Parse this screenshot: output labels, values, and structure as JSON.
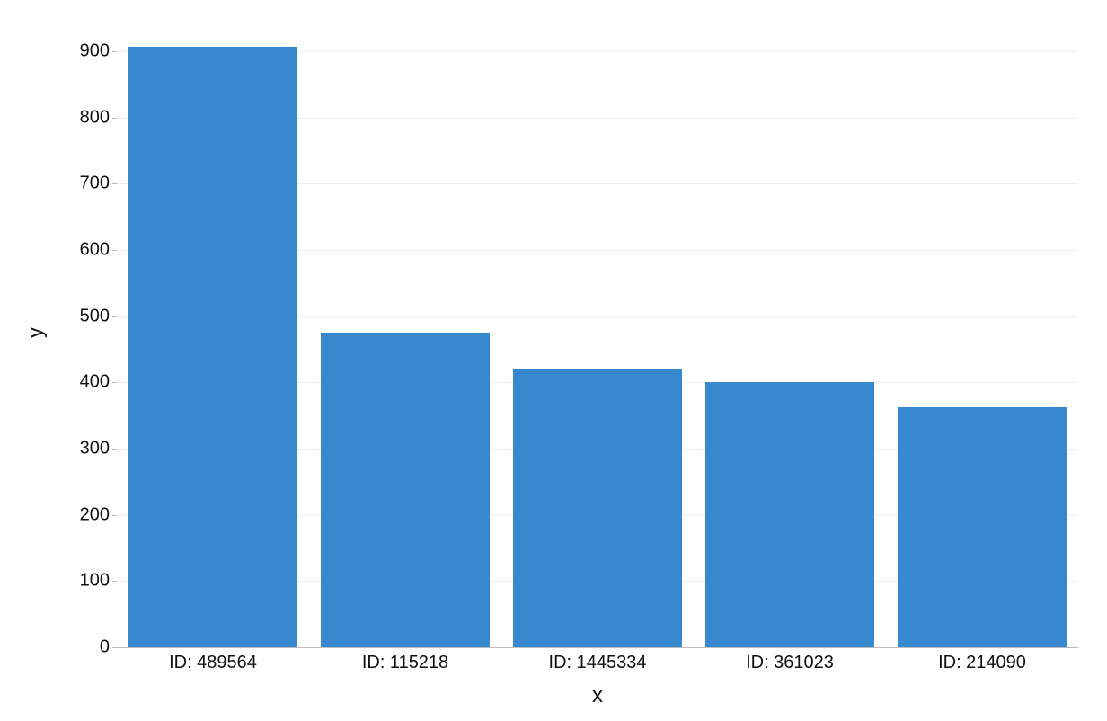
{
  "chart_data": {
    "type": "bar",
    "categories": [
      "ID: 489564",
      "ID: 115218",
      "ID: 1445334",
      "ID: 361023",
      "ID: 214090"
    ],
    "values": [
      907,
      475,
      420,
      400,
      363
    ],
    "title": "",
    "xlabel": "x",
    "ylabel": "y",
    "ylim": [
      0,
      950
    ],
    "yticks": [
      0,
      100,
      200,
      300,
      400,
      500,
      600,
      700,
      800,
      900
    ],
    "bar_color": "#3888d0"
  }
}
